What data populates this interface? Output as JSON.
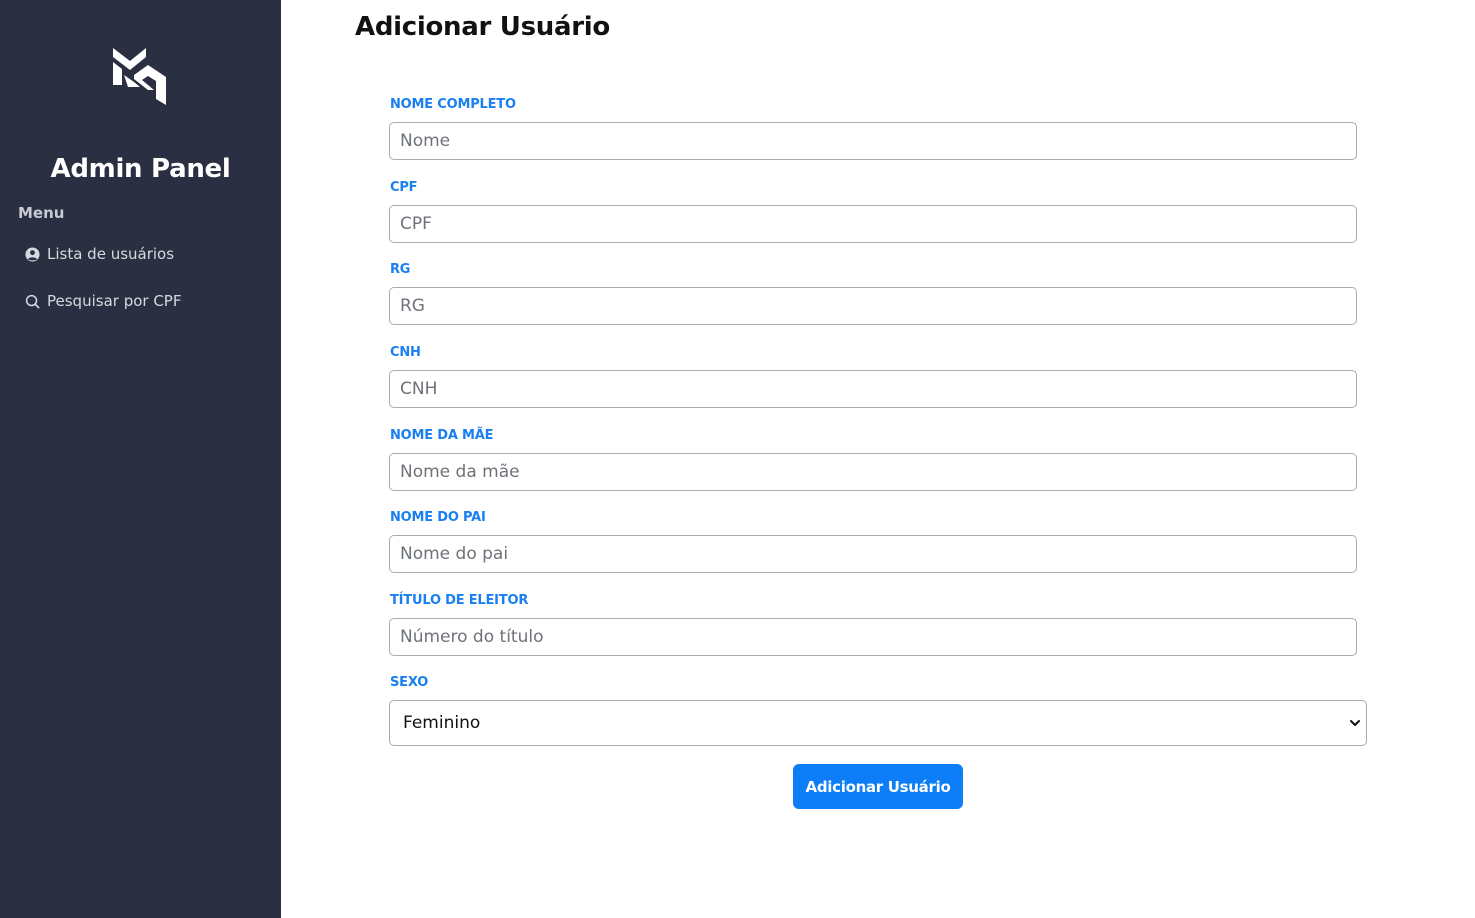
{
  "sidebar": {
    "logo_icon": "mr-monogram-logo",
    "brand": "Admin Panel",
    "menu_title": "Menu",
    "items": [
      {
        "label": "Lista de usuários",
        "icon": "user-circle-icon"
      },
      {
        "label": "Pesquisar por CPF",
        "icon": "search-icon"
      }
    ],
    "background": "#2a3042"
  },
  "main": {
    "title": "Adicionar Usuário",
    "fields": [
      {
        "label": "NOME COMPLETO",
        "placeholder": "Nome",
        "value": ""
      },
      {
        "label": "CPF",
        "placeholder": "CPF",
        "value": ""
      },
      {
        "label": "RG",
        "placeholder": "RG",
        "value": ""
      },
      {
        "label": "CNH",
        "placeholder": "CNH",
        "value": ""
      },
      {
        "label": "NOME DA MÃE",
        "placeholder": "Nome da mãe",
        "value": ""
      },
      {
        "label": "NOME DO PAI",
        "placeholder": "Nome do pai",
        "value": ""
      },
      {
        "label": "TÍTULO DE ELEITOR",
        "placeholder": "Número do título",
        "value": ""
      }
    ],
    "sexo": {
      "label": "SEXO",
      "selected": "Feminino"
    },
    "submit_label": "Adicionar Usuário",
    "accent_color": "#0d7ef8",
    "label_color": "#1a7ff0"
  }
}
